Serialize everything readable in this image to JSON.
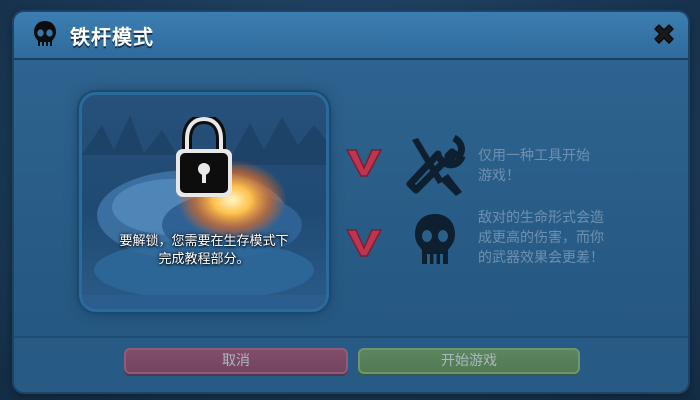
{
  "dialog": {
    "title": "铁杆模式",
    "title_icon": "skull-icon",
    "close_icon": "close-icon"
  },
  "preview": {
    "lock_icon": "padlock-icon",
    "unlock_message_line1": "要解锁，您需要在生存模式下",
    "unlock_message_line2": "完成教程部分。"
  },
  "rules": [
    {
      "check_icon": "check-icon",
      "icon": "tools-icon",
      "line1": "仅用一种工具开始",
      "line2": "游戏！"
    },
    {
      "check_icon": "check-icon",
      "icon": "skull-icon",
      "line1": "敌对的生命形式会造",
      "line2": "成更高的伤害，而你",
      "line3": "的武器效果会更差！"
    }
  ],
  "buttons": {
    "cancel_label": "取消",
    "start_label": "开始游戏"
  },
  "colors": {
    "panel": "#2a5f8a",
    "check": "#c0344f",
    "cancel": "#8a3d53",
    "start": "#5f8445"
  }
}
